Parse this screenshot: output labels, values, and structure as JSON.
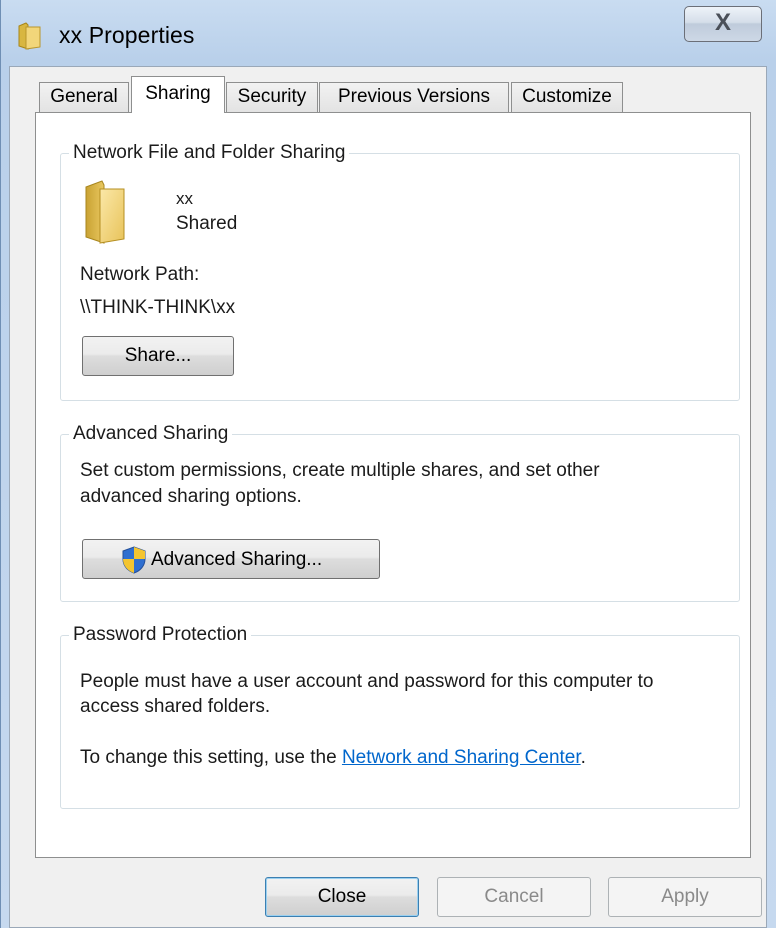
{
  "window": {
    "title": "xx Properties",
    "close_glyph": "X"
  },
  "tabs": [
    {
      "label": "General",
      "active": false
    },
    {
      "label": "Sharing",
      "active": true
    },
    {
      "label": "Security",
      "active": false
    },
    {
      "label": "Previous Versions",
      "active": false
    },
    {
      "label": "Customize",
      "active": false
    }
  ],
  "network_sharing": {
    "title": "Network File and Folder Sharing",
    "folder_icon": "folder-icon",
    "folder_name": "xx",
    "status": "Shared",
    "path_label": "Network Path:",
    "path_value": "\\\\THINK-THINK\\xx",
    "share_button": "Share..."
  },
  "advanced_sharing": {
    "title": "Advanced Sharing",
    "description_line1": "Set custom permissions, create multiple shares, and set other",
    "description_line2": "advanced sharing options.",
    "button_icon": "uac-shield-icon",
    "button_label": "Advanced Sharing..."
  },
  "password_protection": {
    "title": "Password Protection",
    "description_line1": "People must have a user account and password for this computer to",
    "description_line2": "access shared folders.",
    "change_prefix": "To change this setting, use the ",
    "link_text": "Network and Sharing Center",
    "change_suffix": "."
  },
  "footer": {
    "close": "Close",
    "cancel": "Cancel",
    "apply": "Apply"
  },
  "colors": {
    "link": "#0066cc",
    "frame": "#b9d0ea"
  }
}
